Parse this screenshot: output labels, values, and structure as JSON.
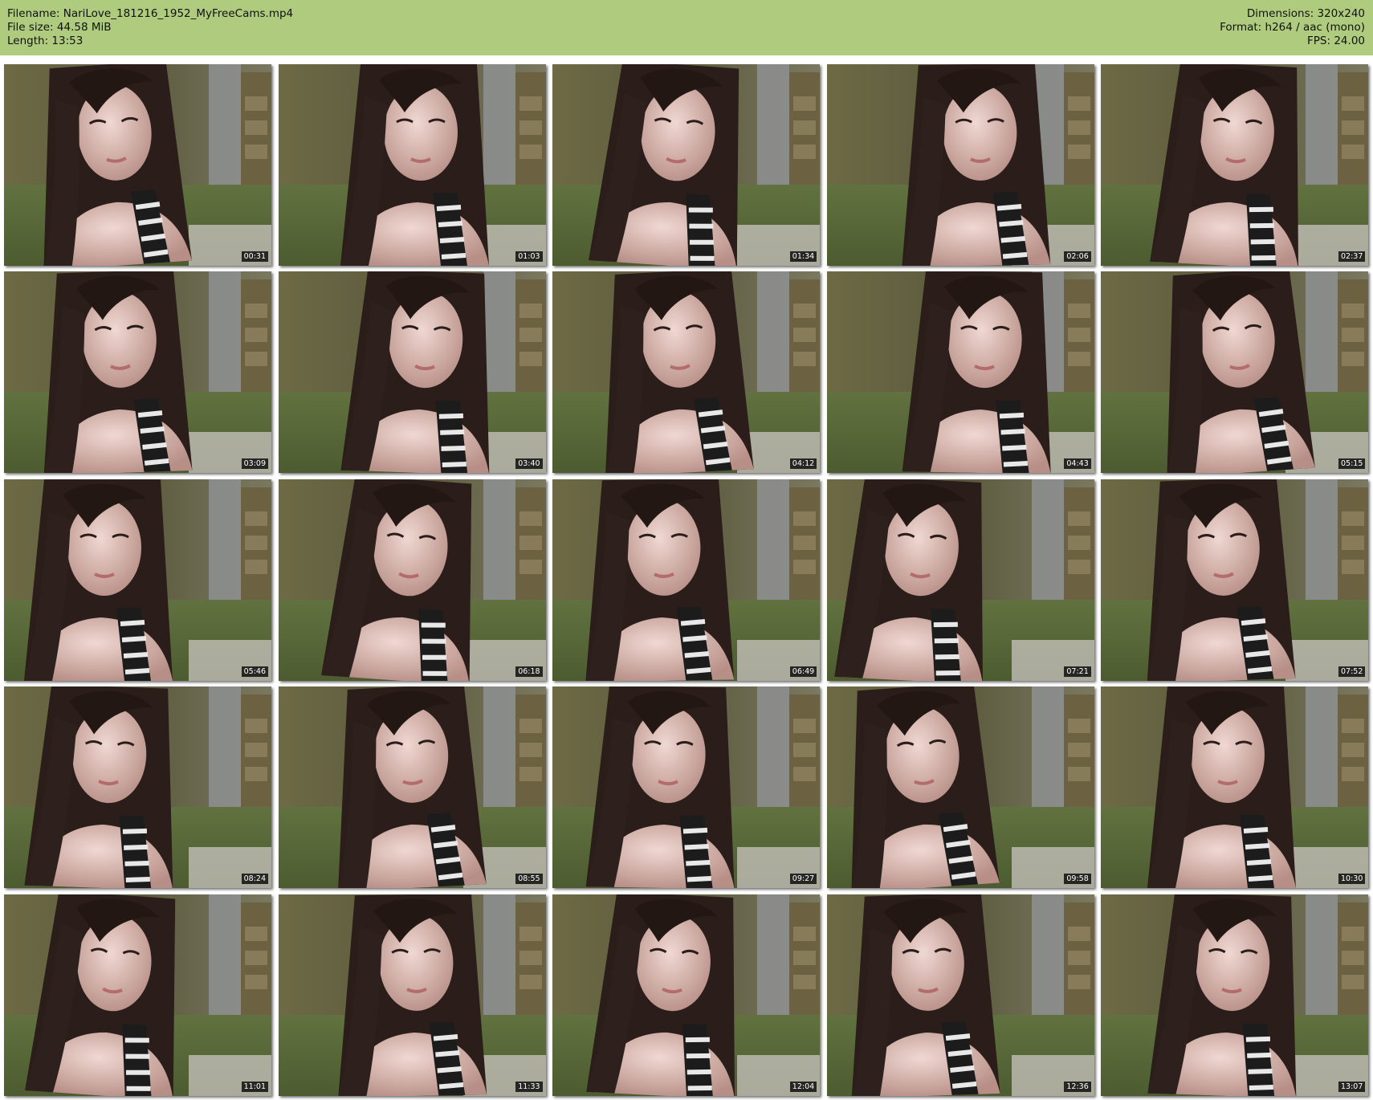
{
  "header": {
    "filename_line": "Filename: NariLove_181216_1952_MyFreeCams.mp4",
    "filesize_line": "File size: 44.58 MiB",
    "length_line": "Length: 13:53",
    "dimensions_line": "Dimensions: 320x240",
    "format_line": "Format: h264 / aac (mono)",
    "fps_line": "FPS: 24.00",
    "background_color": "#afcb7e"
  },
  "thumbnails": [
    {
      "timestamp": "00:31"
    },
    {
      "timestamp": "01:03"
    },
    {
      "timestamp": "01:34"
    },
    {
      "timestamp": "02:06"
    },
    {
      "timestamp": "02:37"
    },
    {
      "timestamp": "03:09"
    },
    {
      "timestamp": "03:40"
    },
    {
      "timestamp": "04:12"
    },
    {
      "timestamp": "04:43"
    },
    {
      "timestamp": "05:15"
    },
    {
      "timestamp": "05:46"
    },
    {
      "timestamp": "06:18"
    },
    {
      "timestamp": "06:49"
    },
    {
      "timestamp": "07:21"
    },
    {
      "timestamp": "07:52"
    },
    {
      "timestamp": "08:24"
    },
    {
      "timestamp": "08:55"
    },
    {
      "timestamp": "09:27"
    },
    {
      "timestamp": "09:58"
    },
    {
      "timestamp": "10:30"
    },
    {
      "timestamp": "11:01"
    },
    {
      "timestamp": "11:33"
    },
    {
      "timestamp": "12:04"
    },
    {
      "timestamp": "12:36"
    },
    {
      "timestamp": "13:07"
    }
  ]
}
